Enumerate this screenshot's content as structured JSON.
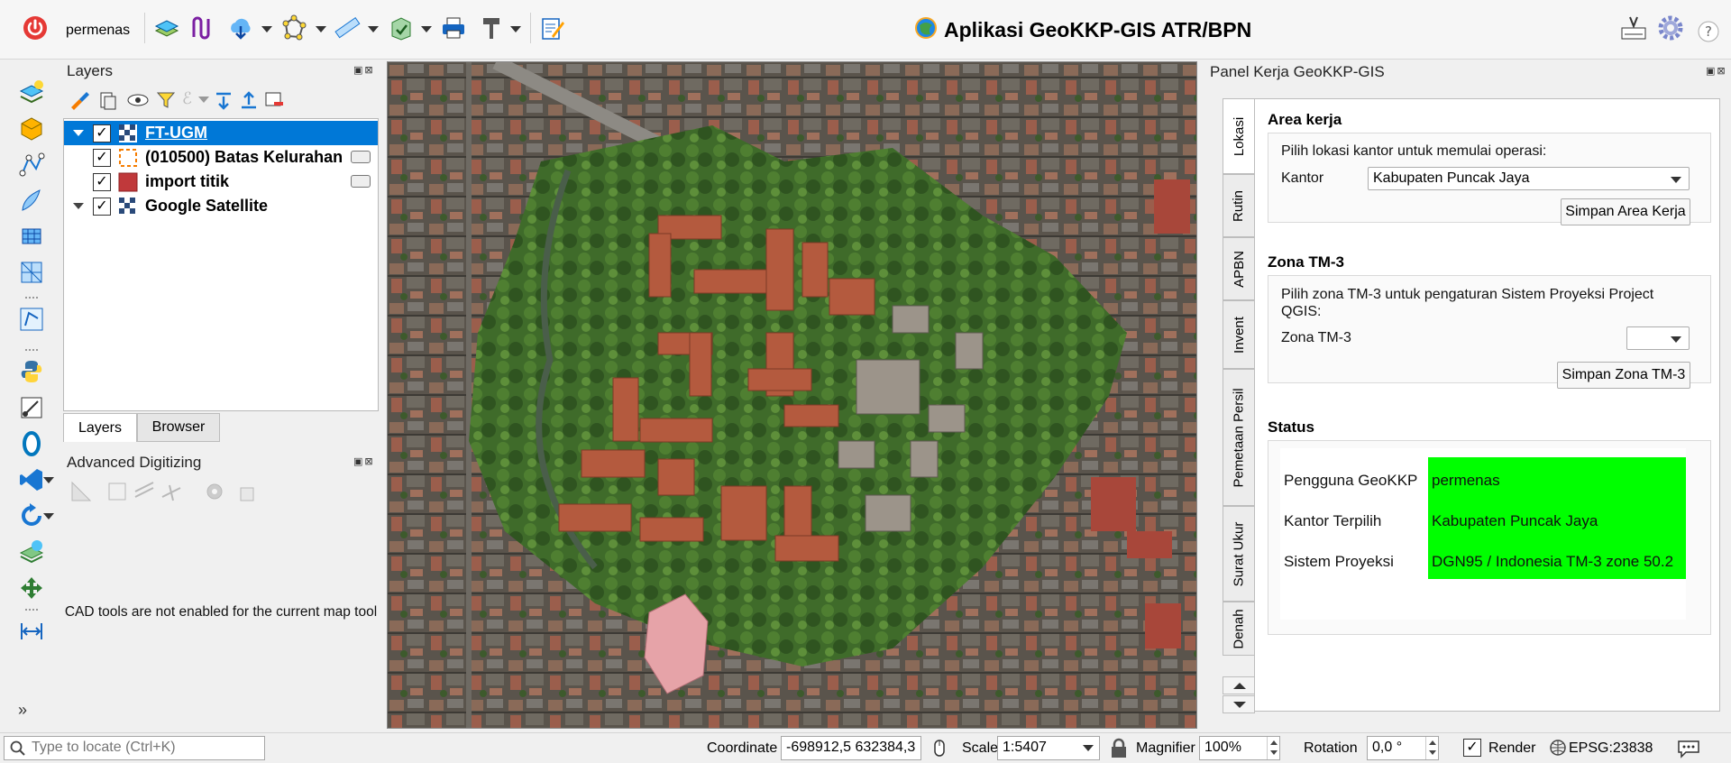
{
  "app": {
    "title": "Aplikasi GeoKKP-GIS ATR/BPN",
    "username": "permenas"
  },
  "layers_panel": {
    "title": "Layers",
    "layers": [
      {
        "name": "FT-UGM",
        "checked": true,
        "selected": true,
        "expandable": true
      },
      {
        "name": "(010500) Batas Kelurahan",
        "checked": true,
        "selected": false,
        "expandable": false
      },
      {
        "name": "import titik",
        "checked": true,
        "selected": false,
        "expandable": false
      },
      {
        "name": "Google Satellite",
        "checked": true,
        "selected": false,
        "expandable": true
      }
    ],
    "tabs": [
      "Layers",
      "Browser"
    ]
  },
  "advanced_digitizing": {
    "title": "Advanced Digitizing",
    "message": "CAD tools are not enabled for the current map tool"
  },
  "right_panel": {
    "title": "Panel Kerja GeoKKP-GIS",
    "vertical_tabs": [
      "Lokasi",
      "Rutin",
      "APBN",
      "Invent",
      "Pemetaan Persil",
      "Surat Ukur",
      "Denah"
    ],
    "area_kerja": {
      "title": "Area kerja",
      "instruction": "Pilih lokasi kantor untuk memulai operasi:",
      "kantor_label": "Kantor",
      "kantor_value": "Kabupaten Puncak Jaya",
      "save_button": "Simpan Area Kerja"
    },
    "zona": {
      "title": "Zona TM-3",
      "instruction": "Pilih zona TM-3 untuk pengaturan Sistem Proyeksi Project QGIS:",
      "label": "Zona TM-3",
      "value": "",
      "save_button": "Simpan Zona TM-3"
    },
    "status": {
      "title": "Status",
      "rows": [
        {
          "label": "Pengguna GeoKKP",
          "value": "permenas"
        },
        {
          "label": "Kantor Terpilih",
          "value": "Kabupaten Puncak Jaya"
        },
        {
          "label": "Sistem Proyeksi",
          "value": "DGN95 / Indonesia TM-3 zone 50.2"
        }
      ],
      "highlight_color": "#00ff00"
    }
  },
  "statusbar": {
    "locate_placeholder": "Type to locate (Ctrl+K)",
    "coordinate_label": "Coordinate",
    "coordinate_value": "-698912,5 632384,3",
    "scale_label": "Scale",
    "scale_value": "1:5407",
    "magnifier_label": "Magnifier",
    "magnifier_value": "100%",
    "rotation_label": "Rotation",
    "rotation_value": "0,0 °",
    "render_label": "Render",
    "render_checked": true,
    "crs": "EPSG:23838"
  },
  "colors": {
    "selection": "#0078d7",
    "status_green": "#00ff00"
  }
}
